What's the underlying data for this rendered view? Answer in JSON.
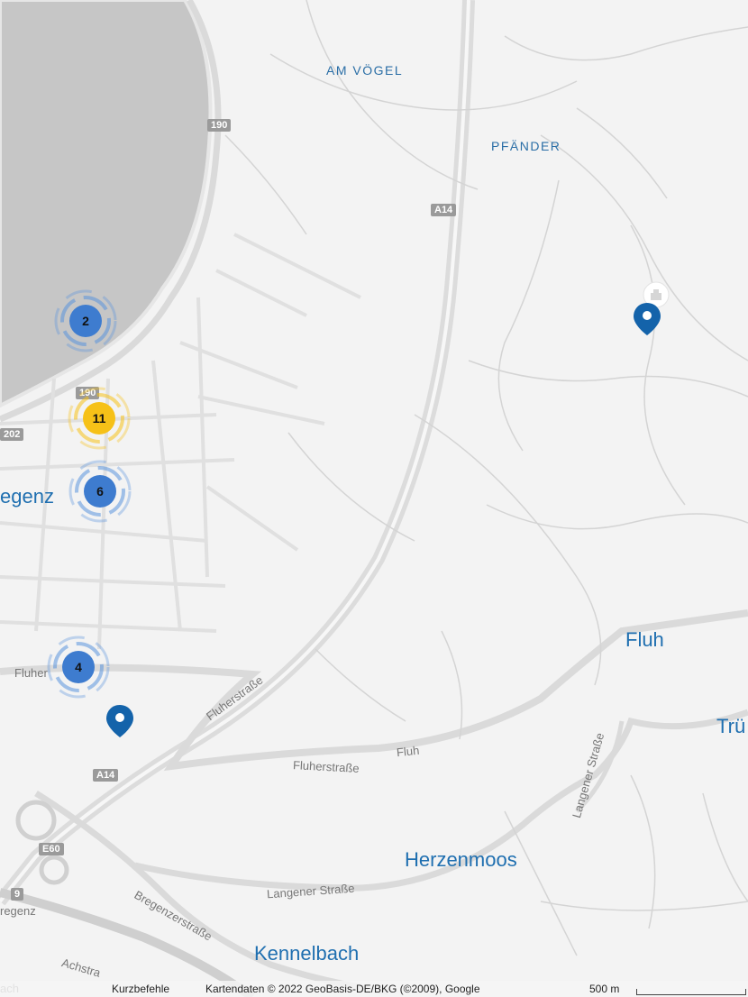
{
  "colors": {
    "water": "#c6c6c6",
    "land": "#f3f3f3",
    "road": "#dcdcdc",
    "label": "#1f6fb0",
    "cluster_blue": "#3e7ccf",
    "cluster_yellow": "#f6c118",
    "pin": "#1463aa"
  },
  "places": {
    "am_vogel": "AM VÖGEL",
    "pfander": "PFÄNDER",
    "fluh": "Fluh",
    "trubach": "Trü",
    "bregenz": "egenz",
    "herzenmoos": "Herzenmoos",
    "kennelbach": "Kennelbach"
  },
  "streets": {
    "fluherstrasse_1": "Fluherstraße",
    "fluherstrasse_2": "Fluherstraße",
    "fluh_road": "Fluh",
    "fluher_left": "Fluher",
    "langener_1": "Langener Straße",
    "langener_2": "Langener Straße",
    "bregenzerstrasse": "Bregenzerstraße",
    "achstrasse": "Achstra",
    "bregenz_edge": "regenz",
    "ach_edge": "ach"
  },
  "shields": {
    "r190_top": "190",
    "r190_mid": "190",
    "a14_top": "A14",
    "a14_bottom": "A14",
    "r202": "202",
    "e60": "E60",
    "r9": "9"
  },
  "clusters": [
    {
      "count": "2",
      "color": "blue"
    },
    {
      "count": "11",
      "color": "yellow"
    },
    {
      "count": "6",
      "color": "blue"
    },
    {
      "count": "4",
      "color": "blue"
    }
  ],
  "attribution": {
    "shortcuts": "Kurzbefehle",
    "data": "Kartendaten © 2022 GeoBasis-DE/BKG (©2009), Google",
    "scale": "500 m"
  }
}
